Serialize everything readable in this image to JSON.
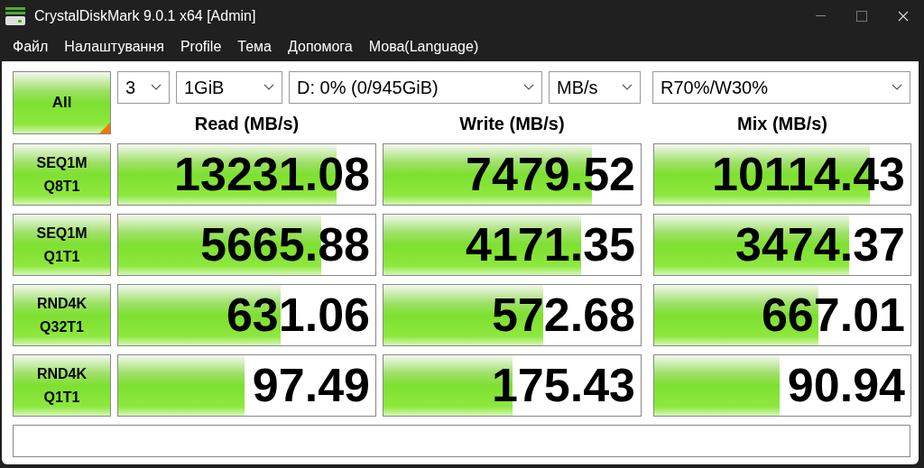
{
  "window": {
    "title": "CrystalDiskMark 9.0.1 x64 [Admin]"
  },
  "menu": [
    "Файл",
    "Налаштування",
    "Profile",
    "Тема",
    "Допомога",
    "Мова(Language)"
  ],
  "all_button": {
    "label": "All"
  },
  "selects": [
    {
      "value": "3"
    },
    {
      "value": "1GiB"
    },
    {
      "value": "D: 0% (0/945GiB)"
    },
    {
      "value": "MB/s"
    },
    {
      "value": "R70%/W30%"
    }
  ],
  "columns": [
    "Read (MB/s)",
    "Write (MB/s)",
    "Mix (MB/s)"
  ],
  "rows": [
    {
      "test": [
        "SEQ1M",
        "Q8T1"
      ],
      "results": [
        {
          "value": "13231.08",
          "level": 0.85
        },
        {
          "value": "7479.52",
          "level": 0.81
        },
        {
          "value": "10114.43",
          "level": 0.84
        }
      ]
    },
    {
      "test": [
        "SEQ1M",
        "Q1T1"
      ],
      "results": [
        {
          "value": "5665.88",
          "level": 0.79
        },
        {
          "value": "4171.35",
          "level": 0.77
        },
        {
          "value": "3474.37",
          "level": 0.76
        }
      ]
    },
    {
      "test": [
        "RND4K",
        "Q32T1"
      ],
      "results": [
        {
          "value": "631.06",
          "level": 0.63
        },
        {
          "value": "572.68",
          "level": 0.62
        },
        {
          "value": "667.01",
          "level": 0.64
        }
      ]
    },
    {
      "test": [
        "RND4K",
        "Q1T1"
      ],
      "results": [
        {
          "value": "97.49",
          "level": 0.49
        },
        {
          "value": "175.43",
          "level": 0.5
        },
        {
          "value": "90.94",
          "level": 0.49
        }
      ]
    }
  ]
}
